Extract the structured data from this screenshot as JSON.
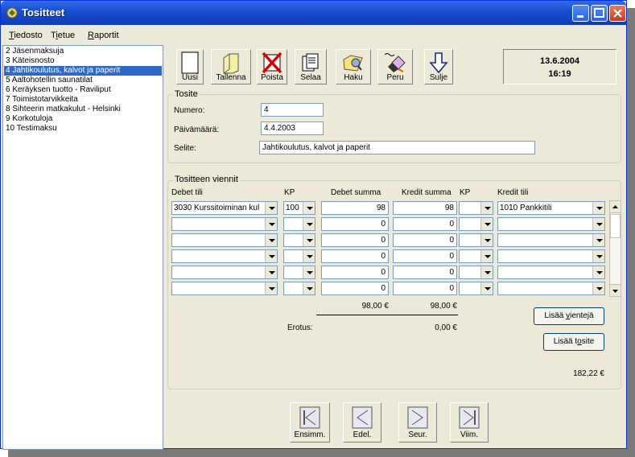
{
  "window": {
    "title": "Tositteet"
  },
  "menu": [
    {
      "pre": "",
      "u": "T",
      "post": "iedosto"
    },
    {
      "pre": "T",
      "u": "i",
      "post": "etue"
    },
    {
      "pre": "",
      "u": "R",
      "post": "aportit"
    }
  ],
  "list": [
    "2 Jäsenmaksuja",
    "3 Käteisnosto",
    "4 Jahtikoulutus, kalvot ja paperit",
    "5 Aaltohotellin saunatilat",
    "6 Keräyksen tuotto - Raviliput",
    "7 Toimistotarvikkeita",
    "8 Sihteerin matkakulut - Helsinki",
    "9 Korkotuloja",
    "10 Testimaksu"
  ],
  "toolbar": {
    "new": "Uusi",
    "save": "Tallenna",
    "delete": "Poista",
    "browse": "Selaa",
    "search": "Haku",
    "cancel": "Peru",
    "close": "Sulje"
  },
  "datetime": {
    "date": "13.6.2004",
    "time": "16:19"
  },
  "tosite": {
    "group_label": "Tosite",
    "numero_label": "Numero:",
    "numero": "4",
    "date_label": "Päivämäärä:",
    "date": "4.4.2003",
    "desc_label": "Selite:",
    "desc": "Jahtikoulutus, kalvot ja paperit"
  },
  "viennit": {
    "group_label": "Tositteen viennit",
    "headers": {
      "debit_account": "Debet tili",
      "kp1": "KP",
      "debit_sum": "Debet summa",
      "credit_sum": "Kredit summa",
      "kp2": "KP",
      "credit_account": "Kredit tili"
    },
    "rows": [
      {
        "debit_account": "3030 Kurssitoiminan kul",
        "kp1": "100",
        "debit": "98",
        "credit": "98",
        "kp2": "",
        "credit_account": "1010 Pankkitili"
      },
      {
        "debit_account": "",
        "kp1": "",
        "debit": "0",
        "credit": "0",
        "kp2": "",
        "credit_account": ""
      },
      {
        "debit_account": "",
        "kp1": "",
        "debit": "0",
        "credit": "0",
        "kp2": "",
        "credit_account": ""
      },
      {
        "debit_account": "",
        "kp1": "",
        "debit": "0",
        "credit": "0",
        "kp2": "",
        "credit_account": ""
      },
      {
        "debit_account": "",
        "kp1": "",
        "debit": "0",
        "credit": "0",
        "kp2": "",
        "credit_account": ""
      },
      {
        "debit_account": "",
        "kp1": "",
        "debit": "0",
        "credit": "0",
        "kp2": "",
        "credit_account": ""
      }
    ],
    "debit_total": "98,00 €",
    "credit_total": "98,00 €",
    "diff_label": "Erotus:",
    "diff": "0,00 €",
    "add_entries": {
      "pre": "Lisää ",
      "u": "v",
      "post": "ientejä"
    },
    "add_voucher": {
      "pre": "Lisää t",
      "u": "o",
      "post": "site"
    },
    "balance": "182,22 €"
  },
  "nav": {
    "first": "Ensimm.",
    "prev": "Edel.",
    "next": "Seur.",
    "last": "Viim."
  }
}
